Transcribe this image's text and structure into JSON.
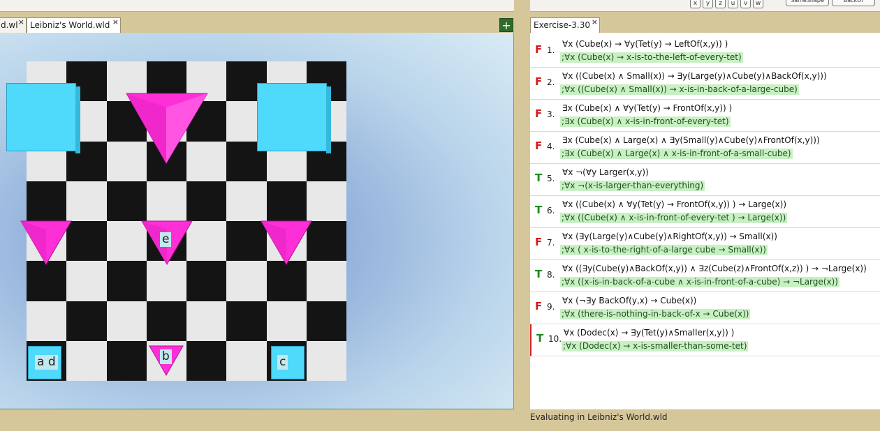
{
  "top_toolbar": {
    "symbols": [
      "x",
      "y",
      "z",
      "u",
      "v",
      "w"
    ],
    "same_shape_label": "SameShape",
    "backof_label": "BackOf"
  },
  "world_tabs": [
    {
      "label": "d.wl",
      "active": false
    },
    {
      "label": "Leibniz's World.wld",
      "active": true
    }
  ],
  "add_button_label": "+",
  "close_glyph": "×",
  "world_objects": {
    "labels": {
      "ad": "a d",
      "b": "b",
      "c": "c",
      "e": "e"
    }
  },
  "colors": {
    "cube": "#4fd9fb",
    "tet": "#ff2fd8",
    "false": "#d21d1d",
    "true": "#1b8a1b"
  },
  "sentence_tab": {
    "label": "Exercise-3.30"
  },
  "sentences": [
    {
      "num": "1.",
      "value": "F",
      "formula": "∀x (Cube(x) → ∀y(Tet(y) → LeftOf(x,y)) )",
      "comment": ";∀x (Cube(x) → x-is-to-the-left-of-every-tet)"
    },
    {
      "num": "2.",
      "value": "F",
      "formula": "∀x ((Cube(x) ∧ Small(x)) → ∃y(Large(y)∧Cube(y)∧BackOf(x,y)))",
      "comment": ";∀x ((Cube(x) ∧ Small(x)) → x-is-in-back-of-a-large-cube)"
    },
    {
      "num": "3.",
      "value": "F",
      "formula": "∃x (Cube(x) ∧ ∀y(Tet(y) → FrontOf(x,y)) )",
      "comment": ";∃x (Cube(x) ∧ x-is-in-front-of-every-tet)"
    },
    {
      "num": "4.",
      "value": "F",
      "formula": "∃x (Cube(x) ∧ Large(x) ∧  ∃y(Small(y)∧Cube(y)∧FrontOf(x,y)))",
      "comment": ";∃x (Cube(x) ∧ Large(x) ∧ x-is-in-front-of-a-small-cube)"
    },
    {
      "num": "5.",
      "value": "T",
      "formula": "∀x ¬(∀y Larger(x,y))",
      "comment": ";∀x ¬(x-is-larger-than-everything)"
    },
    {
      "num": "6.",
      "value": "T",
      "formula": "∀x ((Cube(x) ∧ ∀y(Tet(y) → FrontOf(x,y)) ) → Large(x))",
      "comment": ";∀x ((Cube(x) ∧  x-is-in-front-of-every-tet ) → Large(x))"
    },
    {
      "num": "7.",
      "value": "F",
      "formula": "∀x (∃y(Large(y)∧Cube(y)∧RightOf(x,y))  → Small(x))",
      "comment": ";∀x ( x-is-to-the-right-of-a-large cube → Small(x))"
    },
    {
      "num": "8.",
      "value": "T",
      "formula": "∀x ((∃y(Cube(y)∧BackOf(x,y)) ∧ ∃z(Cube(z)∧FrontOf(x,z)) ) → ¬Large(x))",
      "comment": ";∀x ((x-is-in-back-of-a-cube ∧ x-is-in-front-of-a-cube) → ¬Large(x))"
    },
    {
      "num": "9.",
      "value": "F",
      "formula": "∀x (¬∃y BackOf(y,x) → Cube(x))",
      "comment": ";∀x (there-is-nothing-in-back-of-x → Cube(x))"
    },
    {
      "num": "10.",
      "value": "T",
      "formula": "∀x (Dodec(x) → ∃y(Tet(y)∧Smaller(x,y)) )",
      "comment": ";∀x (Dodec(x) → x-is-smaller-than-some-tet)"
    }
  ],
  "status": "Evaluating in Leibniz's World.wld"
}
